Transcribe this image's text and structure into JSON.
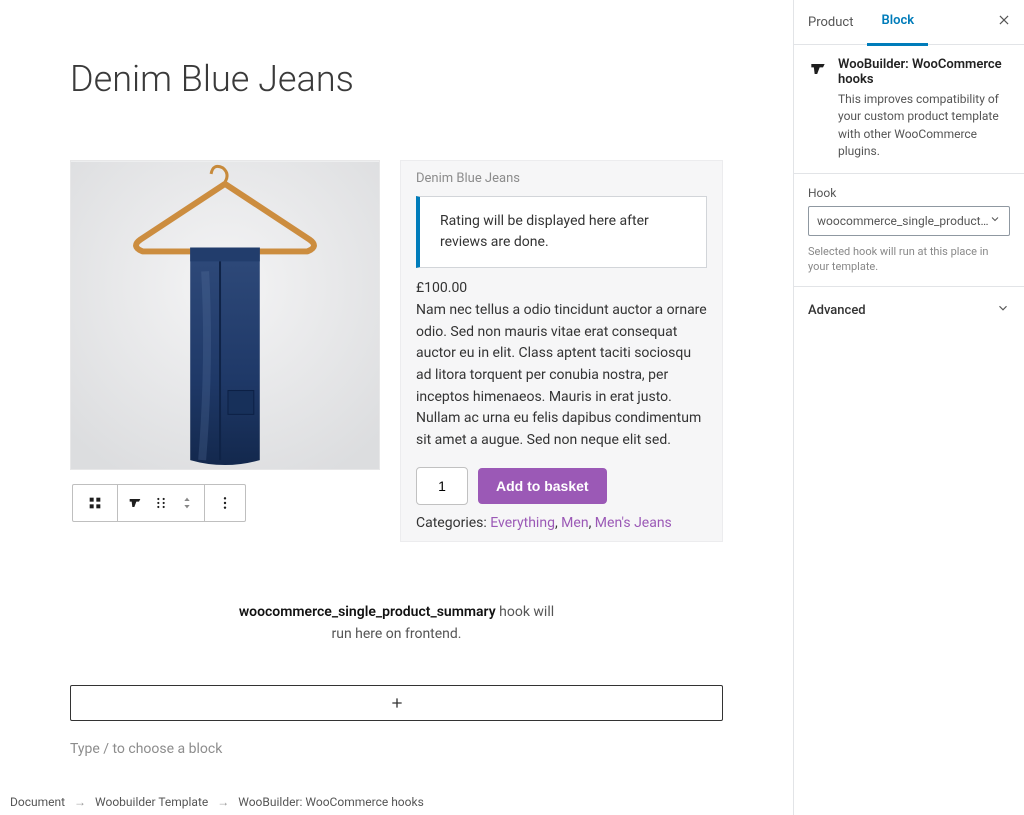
{
  "page": {
    "title": "Denim Blue Jeans"
  },
  "product": {
    "name": "Denim Blue Jeans",
    "rating_msg": "Rating will be displayed here after reviews are done.",
    "price": "£100.00",
    "description": "Nam nec tellus a odio tincidunt auctor a ornare odio. Sed non mauris vitae erat consequat auctor eu in elit. Class aptent taciti sociosqu ad litora torquent per conubia nostra, per inceptos himenaeos. Mauris in erat justo. Nullam ac urna eu felis dapibus condimentum sit amet a augue. Sed non neque elit sed.",
    "qty": "1",
    "add_label": "Add to basket",
    "cat_label": "Categories: ",
    "cats": [
      {
        "label": "Everything",
        "sep": ", "
      },
      {
        "label": "Men",
        "sep": ", "
      },
      {
        "label": "Men's Jeans",
        "sep": ""
      }
    ]
  },
  "hook_block": {
    "hook_name": "woocommerce_single_product_summary",
    "tail": " hook will run here on frontend."
  },
  "placeholder": "Type / to choose a block",
  "breadcrumb": {
    "a": "Document",
    "b": "Woobuilder Template",
    "c": "WooBuilder: WooCommerce hooks"
  },
  "sidebar": {
    "tabs": {
      "product": "Product",
      "block": "Block"
    },
    "block": {
      "title": "WooBuilder: WooCommerce hooks",
      "msg": "This improves compatibility of your custom product template with other WooCommerce plugins."
    },
    "hook": {
      "label": "Hook",
      "value": "woocommerce_single_product_summ",
      "hint": "Selected hook will run at this place in your template."
    },
    "advanced": "Advanced"
  }
}
